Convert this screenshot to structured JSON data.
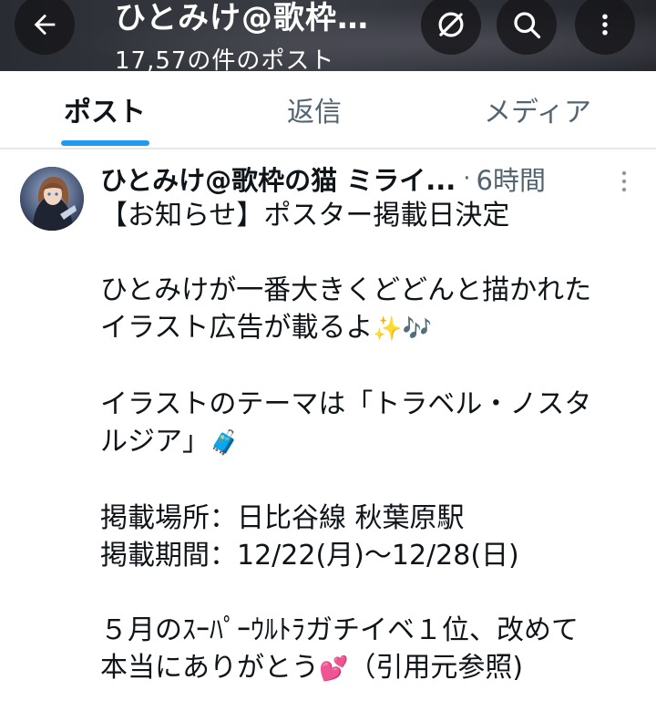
{
  "header": {
    "title": "ひとみけ@歌枠…",
    "post_count": "17,57の件のポスト",
    "icons": {
      "back": "back-arrow-icon",
      "discover": "slashed-circle-icon",
      "search": "search-icon",
      "more": "more-vertical-icon"
    }
  },
  "tabs": [
    {
      "label": "ポスト",
      "active": true
    },
    {
      "label": "返信",
      "active": false
    },
    {
      "label": "メディア",
      "active": false
    }
  ],
  "tweet": {
    "author_name": "ひとみけ@歌枠の猫 ミライ...",
    "separator": "·",
    "time": "6時間",
    "lines": [
      "【お知らせ】ポスター掲載日決定",
      "",
      "ひとみけが一番大きくどどんと描かれた",
      "イラスト広告が載るよ",
      "",
      "イラストのテーマは「トラベル・ノスタ",
      "ルジア」",
      "",
      "掲載場所：日比谷線 秋葉原駅",
      "掲載期間：12/22(月)〜12/28(日)",
      "",
      "５月のｽｰﾊﾟｰｳﾙﾄﾗガチイベ１位、改めて",
      "本当にありがとう",
      "（引用元参照)"
    ],
    "emoji": {
      "sparkles": "✨",
      "notes": "🎶",
      "suitcase": "🧳",
      "hearts": "💕"
    }
  },
  "colors": {
    "accent": "#1d9bf0",
    "text": "#0f1419",
    "secondary": "#536471"
  }
}
